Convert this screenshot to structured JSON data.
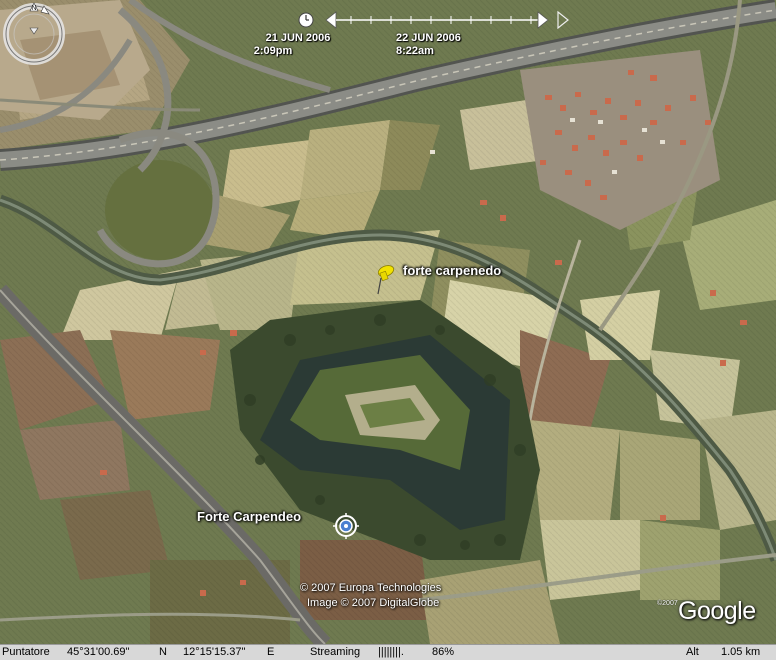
{
  "timebar": {
    "start_date": "21 JUN 2006",
    "start_time": "2:09pm",
    "end_date": "22 JUN 2006",
    "end_time": "8:22am"
  },
  "placemarks": {
    "pin_label": "forte carpenedo",
    "place_label": "Forte Carpendeo"
  },
  "credits": {
    "line1": "© 2007 Europa Technologies",
    "line2": "Image © 2007 DigitalGlobe",
    "google_small": "©2007",
    "google": "Google"
  },
  "status": {
    "pointer_label": "Puntatore",
    "latitude": "45°31'00.69\"",
    "lat_dir": "N",
    "longitude": "12°15'15.37\"",
    "lon_dir": "E",
    "streaming_label": "Streaming",
    "streaming_bar": "||||||||.",
    "streaming_pct": "86%",
    "alt_label": "Alt",
    "alt_value": "1.05 km"
  },
  "colors": {
    "status_bg": "#d8d8d8",
    "pin": "#f2e200",
    "accent_ring": "#4a7fd0"
  }
}
